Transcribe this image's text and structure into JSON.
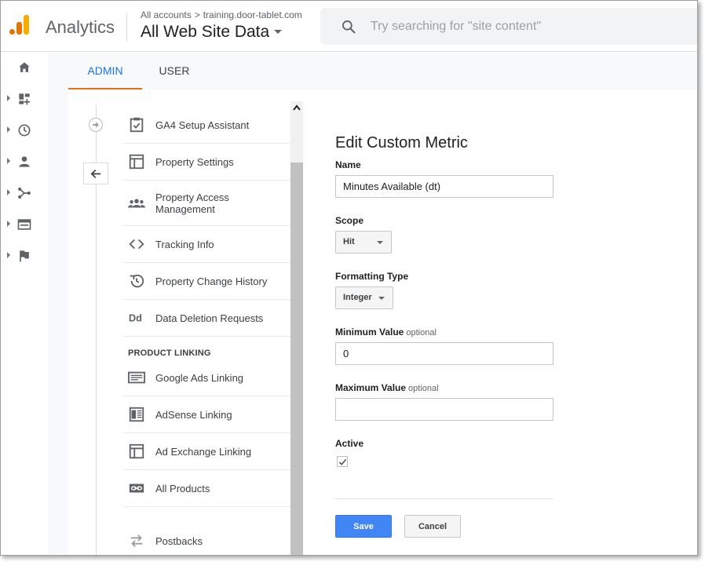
{
  "header": {
    "app_name": "Analytics",
    "breadcrumb_root": "All accounts",
    "breadcrumb_sep": ">",
    "breadcrumb_account": "training.door-tablet.com",
    "view_name": "All Web Site Data",
    "search_placeholder": "Try searching for \"site content\""
  },
  "rail": {
    "icons": [
      "home-icon",
      "customization-icon",
      "realtime-icon",
      "audience-icon",
      "acquisition-icon",
      "behavior-icon",
      "conversions-icon"
    ]
  },
  "tabs": [
    {
      "label": "ADMIN",
      "active": true
    },
    {
      "label": "USER",
      "active": false
    }
  ],
  "nav": {
    "items": [
      {
        "label": "GA4 Setup Assistant",
        "icon": "clipboard-check-icon"
      },
      {
        "label": "Property Settings",
        "icon": "layout-icon"
      },
      {
        "label": "Property Access Management",
        "icon": "people-icon"
      },
      {
        "label": "Tracking Info",
        "icon": "code-icon"
      },
      {
        "label": "Property Change History",
        "icon": "history-icon"
      },
      {
        "label": "Data Deletion Requests",
        "icon": "dd-icon"
      }
    ],
    "section_product_linking": "PRODUCT LINKING",
    "linking_items": [
      {
        "label": "Google Ads Linking",
        "icon": "ads-icon"
      },
      {
        "label": "AdSense Linking",
        "icon": "adsense-icon"
      },
      {
        "label": "Ad Exchange Linking",
        "icon": "ad-exchange-icon"
      },
      {
        "label": "All Products",
        "icon": "link-icon"
      },
      {
        "label": "Postbacks",
        "icon": "postbacks-icon"
      }
    ]
  },
  "form": {
    "title": "Edit Custom Metric",
    "name_label": "Name",
    "name_value": "Minutes Available (dt)",
    "scope_label": "Scope",
    "scope_value": "Hit",
    "formatting_label": "Formatting Type",
    "formatting_value": "Integer",
    "min_label": "Minimum Value",
    "min_optional": "optional",
    "min_value": "0",
    "max_label": "Maximum Value",
    "max_optional": "optional",
    "max_value": "",
    "active_label": "Active",
    "active_checked": true,
    "save_label": "Save",
    "cancel_label": "Cancel"
  },
  "colors": {
    "accent_blue": "#1a73e8",
    "tab_underline": "#e8710a",
    "save_button": "#4285f4",
    "logo_orange": "#e37400",
    "logo_yellow": "#f9ab00"
  }
}
